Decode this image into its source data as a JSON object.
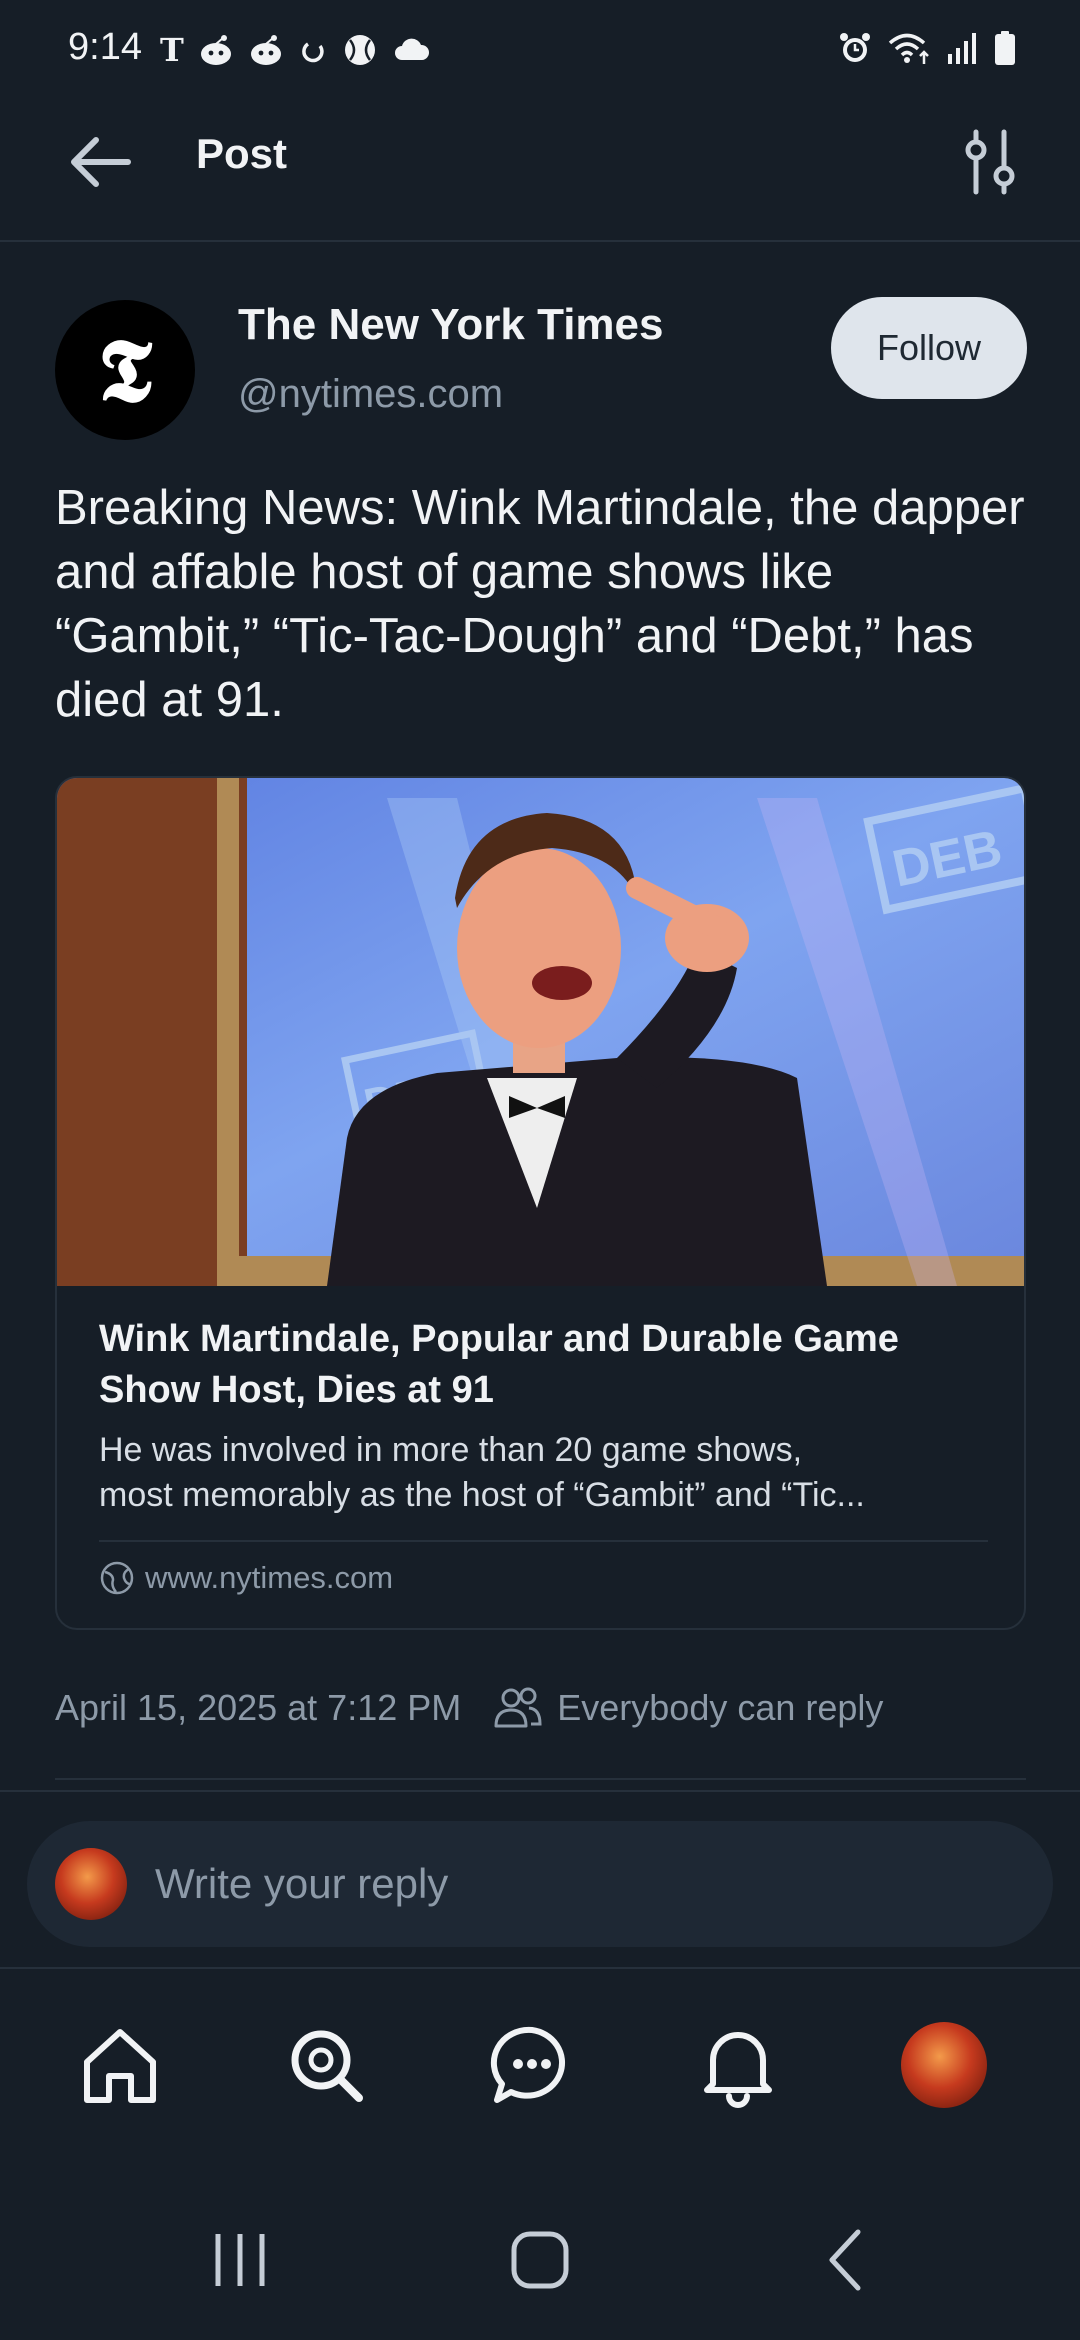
{
  "status_bar": {
    "time": "9:14",
    "left_icons": [
      "T",
      "reddit-icon",
      "reddit-icon",
      "sync-icon",
      "baseball-icon",
      "cloud-icon"
    ],
    "right_icons": [
      "alarm-icon",
      "wifi-icon",
      "signal-icon",
      "battery-icon"
    ]
  },
  "header": {
    "title": "Post"
  },
  "post": {
    "author_name": "The New York Times",
    "author_handle": "@nytimes.com",
    "avatar_letter": "𝕿",
    "follow_label": "Follow",
    "text": "Breaking News: Wink Martindale, the dapper and affable host of game shows like “Gambit,” “Tic-Tac-Dough” and “Debt,” has died at 91.",
    "timestamp": "April 15, 2025 at 7:12 PM",
    "reply_setting": "Everybody can reply"
  },
  "link_card": {
    "image_text": "DEB",
    "title": "Wink Martindale, Popular and Durable Game Show Host, Dies at 91",
    "description": "He was involved in more than 20 game shows,\nmost memorably as the host of “Gambit” and “Tic...",
    "domain": "www.nytimes.com"
  },
  "reply": {
    "placeholder": "Write your reply"
  },
  "nav": {
    "items": [
      "home-icon",
      "search-icon",
      "chat-icon",
      "bell-icon",
      "profile-avatar"
    ]
  },
  "colors": {
    "background": "#161e27",
    "text": "#f1f3f5",
    "muted": "#8d9aa8",
    "follow_bg": "#dfe5ec",
    "card_border": "#26303b"
  }
}
